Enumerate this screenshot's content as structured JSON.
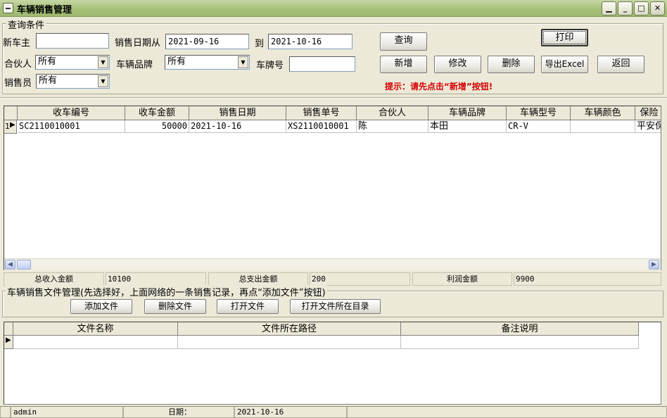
{
  "window": {
    "title": "车辆销售管理"
  },
  "query": {
    "group_label": "查询条件",
    "new_owner_label": "新车主",
    "new_owner_value": "",
    "sale_date_from_label": "销售日期从",
    "sale_date_from": "2021-09-16",
    "to_label": "到",
    "sale_date_to": "2021-10-16",
    "partner_label": "合伙人",
    "partner_value": "所有",
    "brand_label": "车辆品牌",
    "brand_value": "所有",
    "plate_label": "车牌号",
    "plate_value": "",
    "seller_label": "销售员",
    "seller_value": "所有"
  },
  "toolbar": {
    "search": "查询",
    "print": "打印",
    "add": "新增",
    "edit": "修改",
    "delete": "删除",
    "export": "导出Excel",
    "back": "返回",
    "hint": "提示：请先点击“新增”按钮!"
  },
  "sales_grid": {
    "columns": [
      "收车编号",
      "收车金额",
      "销售日期",
      "销售单号",
      "合伙人",
      "车辆品牌",
      "车辆型号",
      "车辆颜色",
      "保险"
    ],
    "rows": [
      {
        "index": "1",
        "cells": [
          "SC2110010001",
          "50000",
          "2021-10-16",
          "XS2110010001",
          "陈",
          "本田",
          "CR-V",
          "",
          "平安保"
        ]
      }
    ]
  },
  "summary": {
    "income_label": "总收入金额",
    "income_value": "10100",
    "expense_label": "总支出金额",
    "expense_value": "200",
    "profit_label": "利润金额",
    "profit_value": "9900"
  },
  "files": {
    "group_label": "车辆销售文件管理(先选择好，上面网络的一条销售记录，再点“添加文件”按钮)",
    "add_file": "添加文件",
    "delete_file": "删除文件",
    "open_file": "打开文件",
    "open_folder": "打开文件所在目录",
    "columns": [
      "文件名称",
      "文件所在路径",
      "备注说明"
    ]
  },
  "status": {
    "user": "admin",
    "date_label": "日期：",
    "date_value": "2021-10-16"
  },
  "colors": {
    "hint": "#d40000",
    "background": "#ece9d8",
    "titlebar": "#a9c27e"
  },
  "icons": [
    "window-menu-icon",
    "minimize-icon",
    "maximize-icon",
    "close-icon",
    "row-pointer-icon",
    "scroll-left-icon",
    "scroll-right-icon"
  ]
}
